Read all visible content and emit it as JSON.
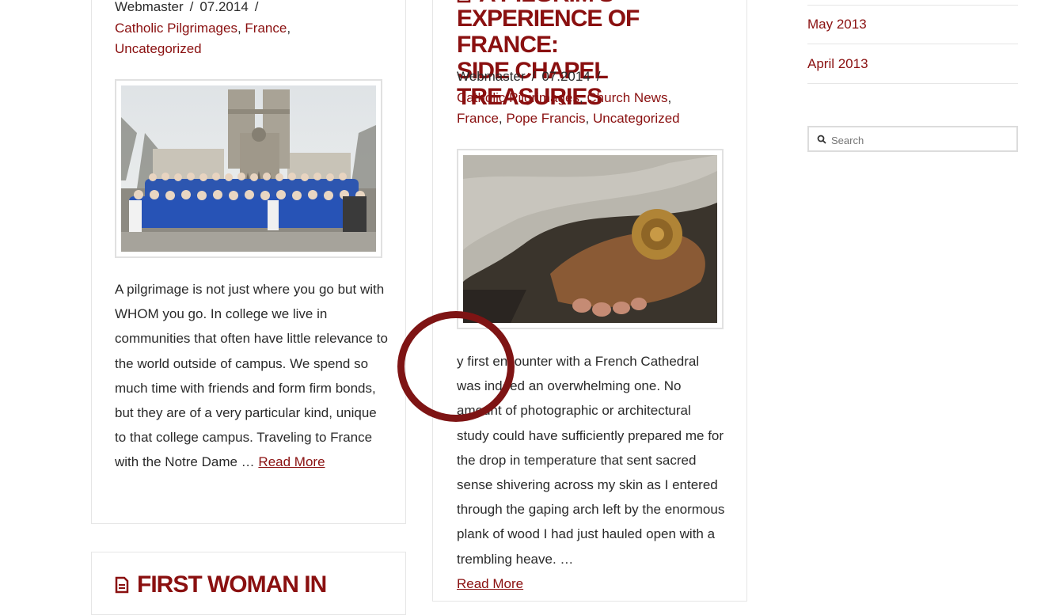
{
  "colors": {
    "accent": "#8a1010",
    "text": "#2a2a2a",
    "border": "#e6e6e6",
    "ring": "#7e1414"
  },
  "post1": {
    "author": "Webmaster",
    "sep1": "/",
    "date": "07.2014",
    "sep2": "/",
    "categories": [
      "Catholic Pilgrimages",
      "France",
      "Uncategorized"
    ],
    "image_icon": "photo-of-choir-before-notre-dame",
    "excerpt": "A pilgrimage is not just where you go but with WHOM you go. In college we live in communities that often have little relevance to the world outside of campus. We spend so much time with friends and form firm bonds, but they are of a very particular kind, unique to that college campus. Traveling to France with the Notre Dame …",
    "read_more": "Read More"
  },
  "post2": {
    "title_top": "A PILGRIM'S",
    "title_line1": "EXPERIENCE OF FRANCE:",
    "title_line2": "SIDE CHAPEL TREASURIES",
    "author": "Webmaster",
    "sep1": "/",
    "date": "07.2014",
    "sep2": "/",
    "categories": [
      "Catholic Pilgrimages",
      "Church News",
      "France",
      "Pope Francis",
      "Uncategorized"
    ],
    "image_icon": "photo-of-statue-foot-with-rose",
    "excerpt": "y first encounter with a French Cathedral was indeed an overwhelming one. No amount of photographic or architectural study could have sufficiently prepared me for the drop in temperature that sent sacred sense shivering across my skin as I entered through the gaping arch left by the enormous plank of wood I had just hauled open with a trembling heave. …",
    "read_more": "Read More"
  },
  "post3": {
    "icon": "document-icon",
    "title": "FIRST WOMAN IN"
  },
  "sidebar": {
    "archives": [
      "May 2013",
      "April 2013"
    ],
    "search_placeholder": "Search"
  }
}
